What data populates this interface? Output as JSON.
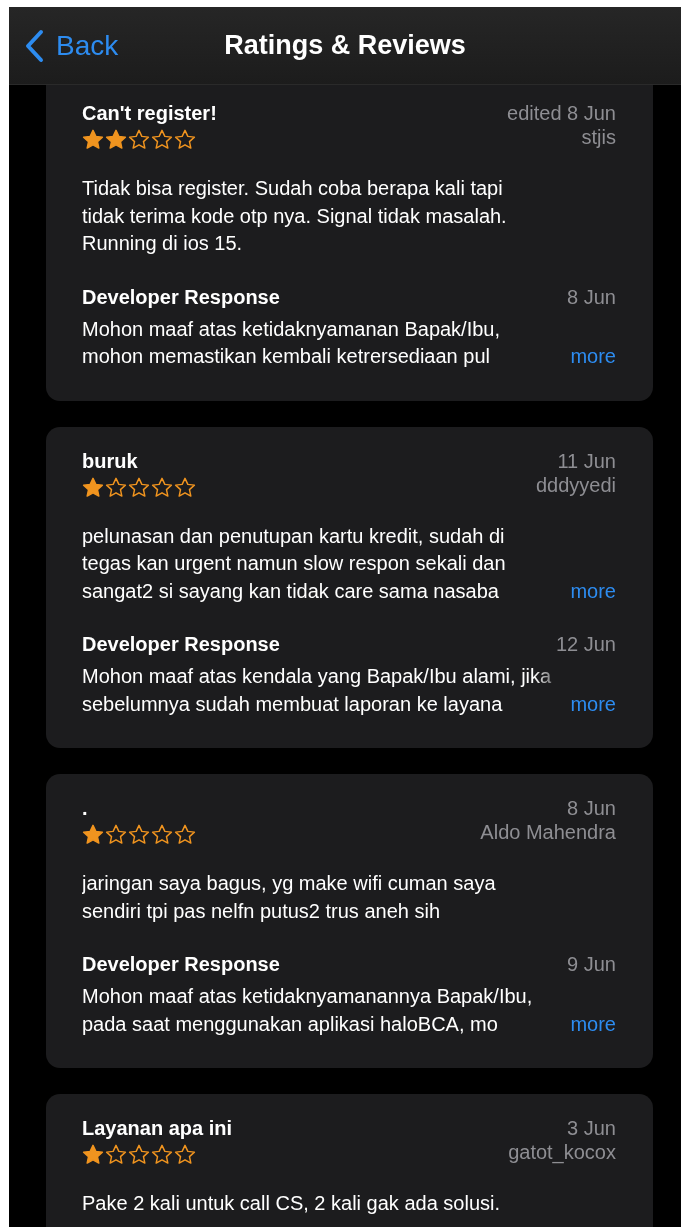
{
  "nav": {
    "back": "Back",
    "title": "Ratings & Reviews"
  },
  "reviews": [
    {
      "title": "Can't register!",
      "date": "edited 8 Jun",
      "stars": 2,
      "author": "stjis",
      "body": "Tidak bisa register. Sudah coba berapa kali tapi\ntidak terima kode otp nya. Signal tidak masalah.\nRunning di ios 15.",
      "response": {
        "label": "Developer Response",
        "date": "8 Jun",
        "body": "Mohon maaf atas ketidaknyamanan Bapak/Ibu,\nmohon memastikan kembali ketrersediaan pul",
        "more": "more"
      }
    },
    {
      "title": "buruk",
      "date": "11 Jun",
      "stars": 1,
      "author": "dddyyedi",
      "body": "pelunasan dan penutupan kartu kredit, sudah di\ntegas kan urgent namun slow respon sekali dan\nsangat2 si sayang kan tidak care sama nasaba",
      "more": "more",
      "response": {
        "label": "Developer Response",
        "date": "12 Jun",
        "body": "Mohon maaf atas kendala yang Bapak/Ibu alami, jika\nsebelumnya sudah membuat laporan ke layana",
        "more": "more"
      }
    },
    {
      "title": ".",
      "date": "8 Jun",
      "stars": 1,
      "author": "Aldo Mahendra",
      "body": "jaringan saya bagus, yg make wifi cuman saya\nsendiri tpi pas nelfn putus2 trus aneh sih",
      "response": {
        "label": "Developer Response",
        "date": "9 Jun",
        "body": "Mohon maaf atas ketidaknyamanannya Bapak/Ibu,\npada saat menggunakan aplikasi haloBCA, mo",
        "more": "more"
      }
    },
    {
      "title": "Layanan apa ini",
      "date": "3 Jun",
      "stars": 1,
      "author": "gatot_kocox",
      "body": "Pake 2 kali untuk call CS, 2 kali gak ada solusi."
    }
  ]
}
